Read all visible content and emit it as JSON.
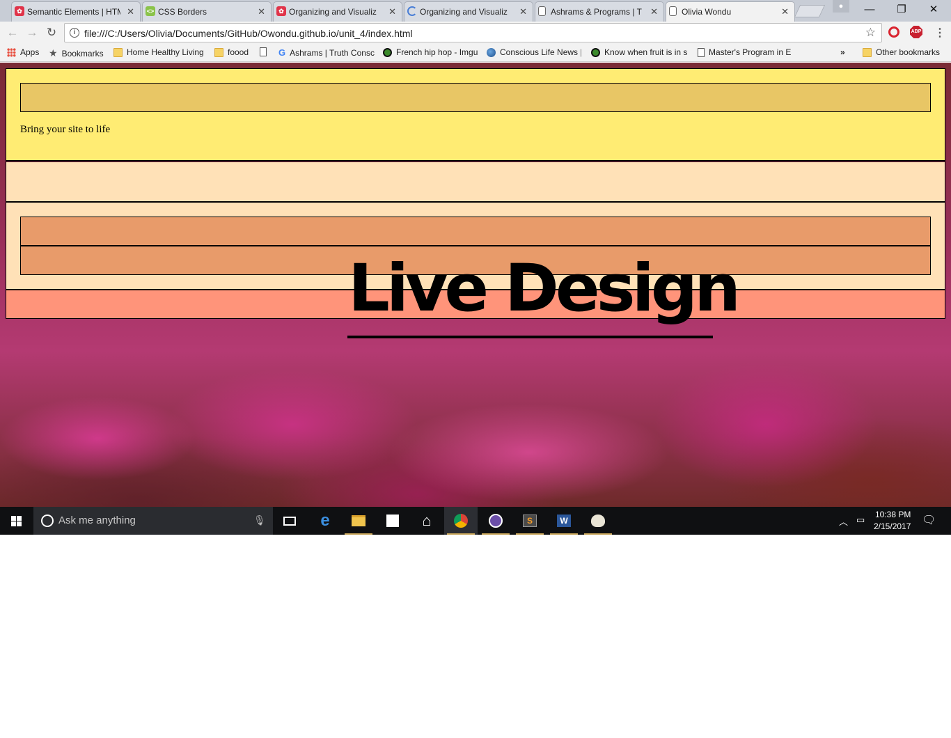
{
  "browser": {
    "tabs": [
      {
        "label": "Semantic Elements | HTM",
        "favicon": "w3-red-icon",
        "active": false
      },
      {
        "label": "CSS Borders",
        "favicon": "green-code-icon",
        "active": false
      },
      {
        "label": "Organizing and Visualiz",
        "favicon": "w3-red-icon",
        "active": false
      },
      {
        "label": "Organizing and Visualiz",
        "favicon": "loading-spinner-icon",
        "active": false
      },
      {
        "label": "Ashrams & Programs | T",
        "favicon": "page-icon",
        "active": false
      },
      {
        "label": "Olivia Wondu",
        "favicon": "page-icon",
        "active": true
      }
    ],
    "url": "file:///C:/Users/Olivia/Documents/GitHub/Owondu.github.io/unit_4/index.html",
    "extensions": {
      "abp_label": "ABP"
    },
    "bookmarks": [
      {
        "label": "Apps",
        "icon": "apps-grid-icon"
      },
      {
        "label": "Bookmarks",
        "icon": "star-icon"
      },
      {
        "label": "Home Healthy Living",
        "icon": "folder-icon"
      },
      {
        "label": "foood",
        "icon": "folder-icon"
      },
      {
        "label": "",
        "icon": "page-icon"
      },
      {
        "label": "Ashrams | Truth Consc",
        "icon": "google-icon"
      },
      {
        "label": "French hip hop - Imgu",
        "icon": "green-circle-icon"
      },
      {
        "label": "Conscious Life News |",
        "icon": "globe-icon"
      },
      {
        "label": "Know when fruit is in s",
        "icon": "green-circle-icon"
      },
      {
        "label": "Master's Program in E",
        "icon": "page-icon"
      }
    ],
    "overflow_label": "»",
    "other_bookmarks": "Other bookmarks"
  },
  "page": {
    "tagline": "Bring your site to life",
    "headline": "Live Design",
    "colors": {
      "header": "#ffec73",
      "header_bar": "#e8c665",
      "nav": "#ffe1b7",
      "main_bar": "#e89b6a",
      "footer": "#ff947a"
    }
  },
  "taskbar": {
    "search_placeholder": "Ask me anything",
    "apps": [
      "task-view-icon",
      "edge-icon",
      "file-explorer-icon",
      "store-icon",
      "home-icon",
      "chrome-icon",
      "cat-app-icon",
      "sublime-text-icon",
      "word-icon",
      "paint-icon"
    ],
    "time": "10:38 PM",
    "date": "2/15/2017"
  }
}
